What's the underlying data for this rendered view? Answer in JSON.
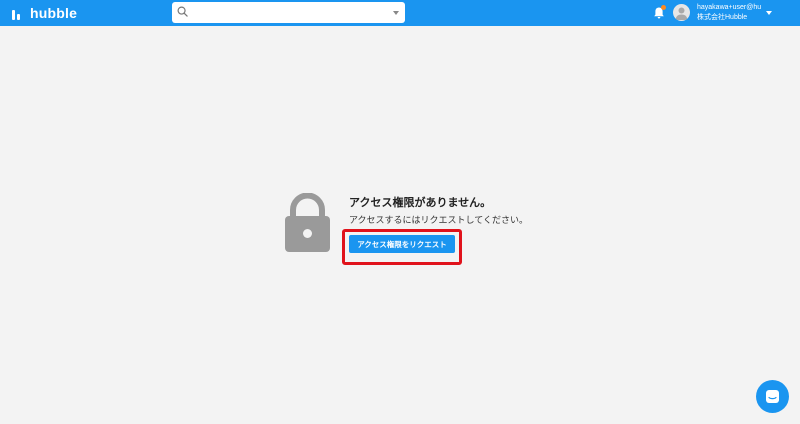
{
  "header": {
    "logo_text": "hubble",
    "search": {
      "value": "",
      "placeholder": ""
    },
    "user": {
      "email": "hayakawa+user@hu...",
      "company": "株式会社Hubble"
    }
  },
  "main": {
    "title": "アクセス権限がありません。",
    "message": "アクセスするにはリクエストしてください。",
    "request_button_label": "アクセス権限をリクエスト"
  },
  "colors": {
    "brand": "#1a95f0",
    "notification_dot": "#ff8a1f",
    "highlight": "#e0121b",
    "lock": "#9a9a9a"
  },
  "icons": [
    "hubble-logo-icon",
    "search-icon",
    "dropdown-caret-icon",
    "bell-icon",
    "avatar-icon",
    "lock-icon",
    "chat-icon"
  ]
}
